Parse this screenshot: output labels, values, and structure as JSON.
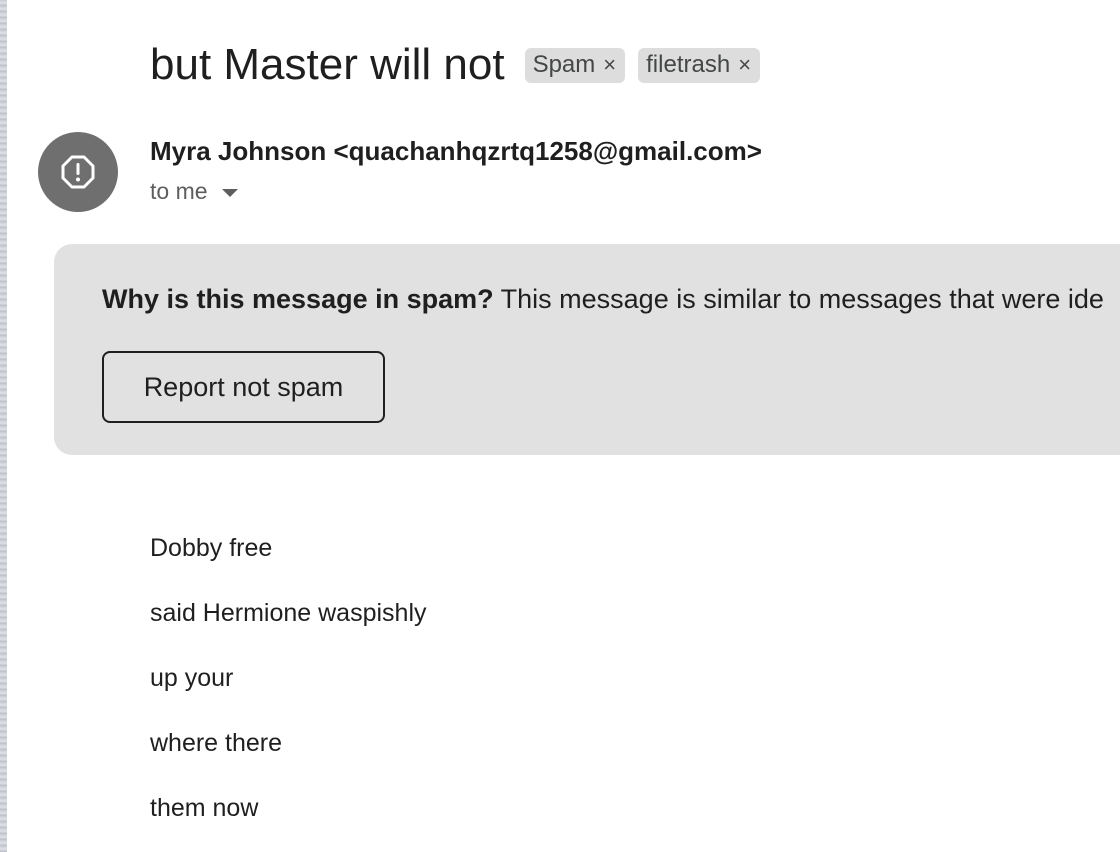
{
  "email": {
    "subject": "but Master will not",
    "labels": [
      {
        "name": "Spam"
      },
      {
        "name": "filetrash"
      }
    ],
    "label_remove_glyph": "×",
    "avatar": {
      "icon": "spam-warning-icon",
      "color": "#6f6f6f"
    },
    "sender_line": "Myra Johnson <quachanhqzrtq1258@gmail.com>",
    "recipient": "to me"
  },
  "spam_notice": {
    "question": "Why is this message in spam?",
    "explanation": "This message is similar to messages that were ide",
    "report_button": "Report not spam"
  },
  "body": {
    "lines": [
      "Dobby free",
      "said Hermione waspishly",
      "up your",
      "where there",
      "them now"
    ]
  }
}
